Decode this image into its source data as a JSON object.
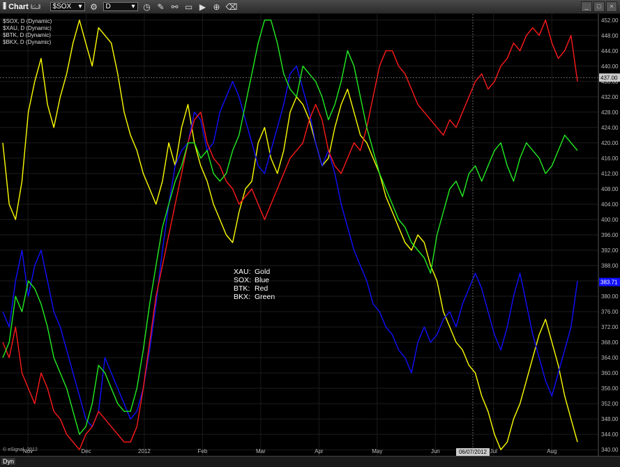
{
  "toolbar": {
    "title": "Chart",
    "badge": "SB",
    "symbol_value": "$SOX",
    "interval_value": "D"
  },
  "legend": [
    "$SOX, D (Dynamic)",
    "$XAU, D (Dynamic)",
    "$BTK, D (Dynamic)",
    "$BKX, D (Dynamic)"
  ],
  "annotation": [
    {
      "key": "XAU:",
      "value": "Gold"
    },
    {
      "key": "SOX:",
      "value": "Blue"
    },
    {
      "key": "BTK:",
      "value": "Red"
    },
    {
      "key": "BKX:",
      "value": "Green"
    }
  ],
  "footer": {
    "dyn_label": "Dyn",
    "copyright": "© eSignal, 2012",
    "crosshair_date": "06/07/2012"
  },
  "colors": {
    "XAU": "#ffff00",
    "SOX": "#1010ff",
    "BTK": "#ff1a1a",
    "BKX": "#22ee22",
    "last_price_box": "#1010ff",
    "crosshair_box": "#cccccc"
  },
  "chart_data": {
    "type": "line",
    "y_ticks": [
      340,
      344,
      348,
      352,
      356,
      360,
      364,
      368,
      372,
      376,
      380,
      384,
      388,
      392,
      396,
      400,
      404,
      408,
      412,
      416,
      420,
      424,
      428,
      432,
      436,
      440,
      444,
      448,
      452
    ],
    "ylim": [
      338.4,
      453.6
    ],
    "x_tick_labels": [
      "Nov",
      "Dec",
      "2012",
      "Feb",
      "Mar",
      "Apr",
      "May",
      "Jun",
      "Jul",
      "Aug"
    ],
    "price_markers": [
      {
        "label": "437.00",
        "value": 437.0,
        "style": "crosshair"
      },
      {
        "label": "383.71",
        "value": 383.71,
        "style": "last"
      }
    ],
    "crosshair_x_label": "06/07/2012",
    "x": [
      0,
      3,
      6,
      9,
      12,
      15,
      18,
      21,
      24,
      27,
      30,
      33,
      36,
      39,
      42,
      45,
      48,
      51,
      54,
      57,
      60,
      63,
      66,
      69,
      72,
      75,
      78,
      81,
      84,
      87,
      90,
      93,
      96,
      99,
      102,
      105,
      108,
      111,
      114,
      117,
      120,
      123,
      126,
      129,
      132,
      135,
      138,
      141,
      144,
      147,
      150,
      153,
      156,
      159,
      162,
      165,
      168,
      171,
      174,
      177,
      180,
      183,
      186,
      189,
      192,
      195,
      198,
      201,
      204,
      207,
      210,
      213,
      216,
      219,
      222,
      225,
      228,
      231,
      234,
      237,
      240,
      243,
      246,
      249,
      252,
      255,
      258,
      261,
      264,
      267,
      270
    ],
    "series": [
      {
        "name": "XAU",
        "values": [
          420,
          404,
          400,
          410,
          428,
          436,
          442,
          430,
          424,
          432,
          438,
          446,
          452,
          446,
          440,
          450,
          448,
          446,
          438,
          428,
          422,
          418,
          412,
          408,
          404,
          410,
          420,
          414,
          424,
          430,
          420,
          414,
          410,
          404,
          400,
          396,
          394,
          402,
          408,
          410,
          420,
          424,
          416,
          412,
          418,
          428,
          432,
          430,
          426,
          420,
          414,
          416,
          424,
          430,
          434,
          428,
          422,
          420,
          416,
          412,
          406,
          402,
          398,
          394,
          392,
          396,
          394,
          388,
          384,
          376,
          372,
          368,
          366,
          362,
          360,
          354,
          350,
          344,
          340,
          342,
          348,
          352,
          358,
          364,
          370,
          374,
          368,
          362,
          354,
          348,
          342
        ]
      },
      {
        "name": "SOX",
        "values": [
          376,
          372,
          384,
          392,
          380,
          388,
          392,
          384,
          376,
          372,
          366,
          360,
          354,
          348,
          346,
          350,
          364,
          360,
          356,
          352,
          348,
          350,
          356,
          366,
          378,
          392,
          404,
          414,
          418,
          420,
          428,
          426,
          418,
          420,
          428,
          432,
          436,
          432,
          426,
          420,
          414,
          412,
          418,
          424,
          430,
          438,
          440,
          434,
          428,
          420,
          414,
          418,
          412,
          404,
          398,
          392,
          388,
          384,
          378,
          376,
          372,
          370,
          366,
          364,
          360,
          368,
          372,
          368,
          370,
          374,
          376,
          372,
          378,
          382,
          386,
          382,
          376,
          370,
          366,
          372,
          380,
          386,
          378,
          370,
          364,
          358,
          354,
          360,
          366,
          372,
          384
        ]
      },
      {
        "name": "BTK",
        "values": [
          368,
          364,
          372,
          360,
          356,
          352,
          360,
          356,
          350,
          348,
          344,
          342,
          340,
          344,
          346,
          350,
          348,
          346,
          344,
          342,
          342,
          346,
          356,
          368,
          380,
          388,
          396,
          404,
          412,
          420,
          426,
          428,
          420,
          416,
          414,
          410,
          408,
          404,
          406,
          408,
          404,
          400,
          404,
          408,
          412,
          416,
          418,
          420,
          426,
          430,
          426,
          418,
          414,
          412,
          416,
          420,
          418,
          424,
          432,
          440,
          444,
          444,
          440,
          438,
          434,
          430,
          428,
          426,
          424,
          422,
          426,
          424,
          428,
          432,
          436,
          438,
          434,
          436,
          440,
          442,
          446,
          444,
          448,
          450,
          448,
          452,
          446,
          442,
          444,
          448,
          436
        ]
      },
      {
        "name": "BKX",
        "values": [
          364,
          368,
          380,
          376,
          384,
          382,
          378,
          372,
          364,
          360,
          356,
          350,
          344,
          346,
          352,
          362,
          360,
          356,
          352,
          350,
          350,
          356,
          366,
          378,
          388,
          398,
          404,
          410,
          414,
          420,
          420,
          416,
          418,
          412,
          410,
          412,
          418,
          422,
          430,
          438,
          446,
          452,
          452,
          446,
          438,
          434,
          432,
          440,
          438,
          436,
          432,
          426,
          430,
          436,
          444,
          440,
          432,
          424,
          418,
          412,
          408,
          404,
          400,
          398,
          394,
          392,
          390,
          386,
          396,
          402,
          408,
          410,
          406,
          412,
          414,
          410,
          414,
          418,
          420,
          414,
          410,
          416,
          420,
          418,
          416,
          412,
          414,
          418,
          422,
          420,
          418
        ]
      }
    ]
  }
}
